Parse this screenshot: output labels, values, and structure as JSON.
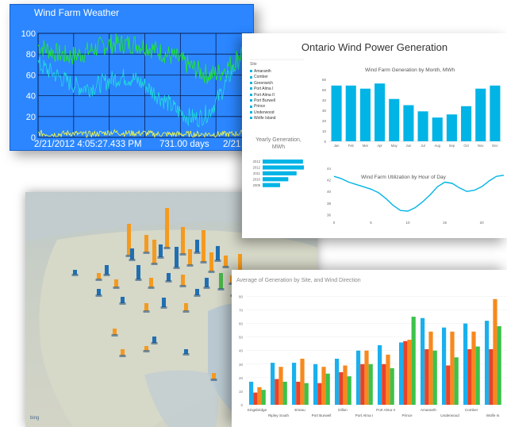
{
  "weather": {
    "title": "Wind Farm Weather",
    "footer_timestamp": "2/21/2012 4:05:27.433 PM",
    "footer_span": "731.00 days",
    "footer_right": "2/21",
    "colors": {
      "background": "#2b86ff",
      "series_green": "#22ee22",
      "series_cyan": "#22dddd",
      "series_yellow": "#ffff33"
    }
  },
  "ontario": {
    "title": "Ontario Wind Power Generation",
    "legend_heading": "Site",
    "legend_items": [
      "Amaranth",
      "Comber",
      "Greenwich",
      "Port Alma I",
      "Port Alma II",
      "Port Burwell",
      "Prince",
      "Underwood",
      "Wolfe Island"
    ],
    "monthly_title": "Wind Farm Generation by Month, MWh",
    "utilization_title": "Wind Farm Utilization by Hour of Day",
    "yearly_title_line1": "Yearly Generation,",
    "yearly_title_line2": "MWh",
    "accent": "#00b4e6"
  },
  "map": {
    "bing_label": "bing"
  },
  "avg": {
    "title": "Average of Generation by Site, and Wind Direction",
    "colors": [
      "#1ab0ee",
      "#e8432a",
      "#f7891e",
      "#3dc24a"
    ]
  },
  "chart_data": [
    {
      "type": "line",
      "title": "Wind Farm Weather",
      "ylim": [
        0,
        100
      ],
      "yticks": [
        "0",
        "20",
        "40",
        "60",
        "80",
        "100"
      ],
      "grid": true,
      "series": [
        {
          "values": [
            88,
            84,
            80,
            78,
            80,
            84,
            88,
            90,
            90,
            90,
            88,
            84,
            80,
            76,
            70,
            64,
            60,
            62,
            70,
            80,
            86
          ]
        },
        {
          "values": [
            70,
            64,
            58,
            52,
            48,
            48,
            52,
            56,
            58,
            56,
            50,
            42,
            34,
            26,
            20,
            18,
            24,
            40,
            60,
            78,
            84
          ]
        },
        {
          "values": [
            4,
            3,
            3,
            4,
            3,
            3,
            4,
            5,
            4,
            4,
            4,
            3,
            3,
            3,
            3,
            3,
            3,
            3,
            3,
            4,
            4
          ]
        }
      ]
    },
    {
      "type": "bar",
      "title": "Wind Farm Generation by Month, MWh",
      "categories": [
        "Jan",
        "Feb",
        "Mar",
        "Apr",
        "May",
        "Jun",
        "Jul",
        "Aug",
        "Sep",
        "Oct",
        "Nov",
        "Dec"
      ],
      "values": [
        54,
        54,
        51,
        56,
        41,
        35,
        29,
        23,
        26,
        34,
        51,
        54
      ],
      "yticks": [
        "0",
        "10",
        "20",
        "30",
        "40",
        "50",
        "60"
      ],
      "ylim": [
        0,
        60
      ]
    },
    {
      "type": "bar",
      "title": "Yearly Generation, MWh",
      "categories": [
        "2013",
        "2012",
        "2011",
        "2010",
        "2009"
      ],
      "values": [
        88,
        90,
        74,
        56,
        38
      ]
    },
    {
      "type": "line",
      "title": "Wind Farm Utilization by Hour of Day",
      "x": [
        0,
        1,
        2,
        3,
        4,
        5,
        6,
        7,
        8,
        9,
        10,
        11,
        12,
        13,
        14,
        15,
        16,
        17,
        18,
        19,
        20,
        21,
        22,
        23
      ],
      "values": [
        42.6,
        42.2,
        41.6,
        41.2,
        40.8,
        40.4,
        39.8,
        38.8,
        37.6,
        36.7,
        36.6,
        37.2,
        38.2,
        39.4,
        40.8,
        41.6,
        41.4,
        40.6,
        40.0,
        40.2,
        40.8,
        41.8,
        42.6,
        42.8
      ],
      "xticks": [
        "0",
        "5",
        "10",
        "15",
        "20"
      ],
      "yticks": [
        "36",
        "38",
        "40",
        "42",
        "44"
      ],
      "ylim": [
        35.5,
        44
      ]
    },
    {
      "type": "bar",
      "title": "Average of Generation by Site, and Wind Direction",
      "categories": [
        "Kingsbridge",
        "Ripley South",
        "Erieau",
        "Port Burwell",
        "Dillon",
        "Port Alma I",
        "Port Alma II",
        "Prince",
        "Amaranth",
        "Underwood",
        "Comber",
        "Wolfe Is"
      ],
      "yticks": [
        "0",
        "10",
        "20",
        "30",
        "40",
        "50",
        "60",
        "70",
        "80"
      ],
      "ylim": [
        0,
        82
      ],
      "series": [
        {
          "values": [
            17,
            31,
            31,
            30,
            34,
            40,
            44,
            46,
            64,
            57,
            60,
            62
          ]
        },
        {
          "values": [
            9,
            19,
            17,
            16,
            24,
            30,
            30,
            47,
            41,
            29,
            41,
            41
          ]
        },
        {
          "values": [
            13,
            28,
            34,
            28,
            29,
            40,
            37,
            48,
            54,
            54,
            54,
            78
          ]
        },
        {
          "values": [
            11,
            17,
            16,
            23,
            21,
            30,
            27,
            65,
            40,
            35,
            43,
            58
          ]
        }
      ]
    }
  ]
}
